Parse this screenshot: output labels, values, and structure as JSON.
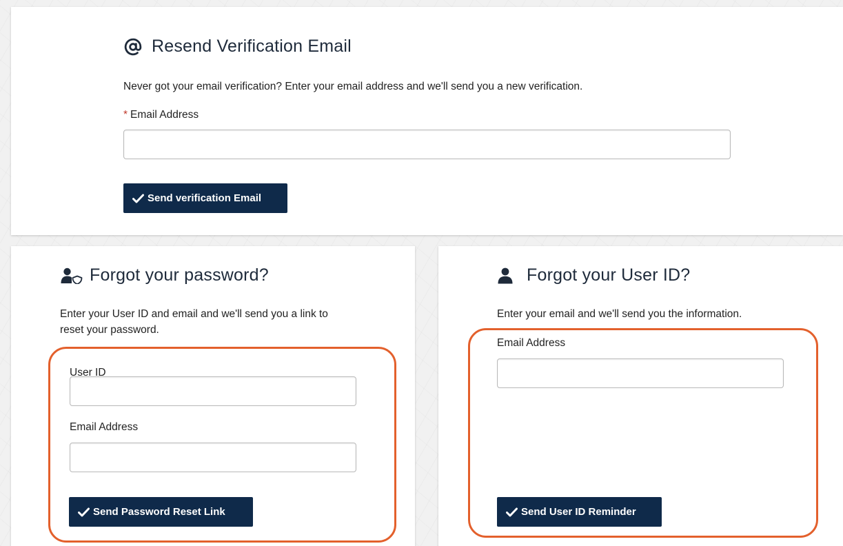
{
  "verification": {
    "title": "Resend Verification Email",
    "icon": "at-sign-icon",
    "description": "Never got your email verification? Enter your email address and we'll send you a new verification.",
    "required_marker": "*",
    "email_label": "Email Address",
    "email_value": "",
    "button_label": "Send verification Email"
  },
  "forgot_password": {
    "title": "Forgot your password?",
    "icon": "user-shield-icon",
    "description": "Enter your User ID and email and we'll send you a link to reset your password.",
    "userid_label": "User ID",
    "userid_value": "",
    "email_label": "Email Address",
    "email_value": "",
    "button_label": "Send Password Reset Link"
  },
  "forgot_userid": {
    "title": "Forgot your User ID?",
    "icon": "user-icon",
    "description": "Enter your email and we'll send you the information.",
    "email_label": "Email Address",
    "email_value": "",
    "button_label": "Send User ID Reminder"
  },
  "colors": {
    "button_bg": "#0f2a4a",
    "highlight": "#e3602c",
    "required": "#c0392b"
  }
}
